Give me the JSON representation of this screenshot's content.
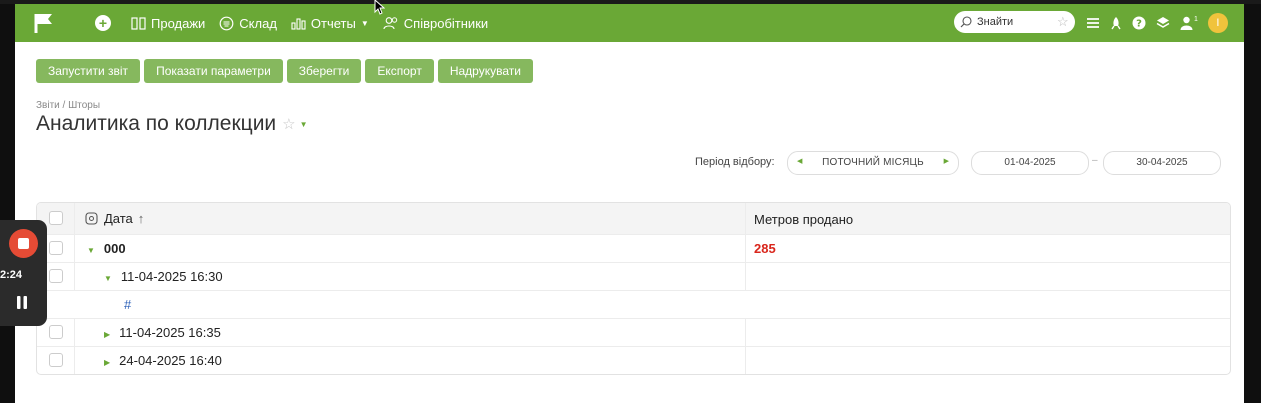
{
  "nav": {
    "menu": [
      {
        "label": "Продажи",
        "icon": "grid-icon",
        "caret": false
      },
      {
        "label": "Склад",
        "icon": "warehouse-icon",
        "caret": false
      },
      {
        "label": "Отчеты",
        "icon": "reports-icon",
        "caret": true
      },
      {
        "label": "Співробітники",
        "icon": "users-icon",
        "caret": false
      }
    ],
    "search_placeholder": "Знайти",
    "notification_count": "1",
    "avatar_letter": "I"
  },
  "toolbar": {
    "run_label": "Запустити звіт",
    "params_label": "Показати параметри",
    "save_label": "Зберегти",
    "export_label": "Експорт",
    "print_label": "Надрукувати"
  },
  "breadcrumb": "Звіти / Шторы",
  "page_title": "Аналитика по коллекции",
  "period": {
    "label": "Період відбору:",
    "value": "ПОТОЧНИЙ МІСЯЦЬ",
    "date_from": "01-04-2025",
    "date_sep": "–",
    "date_to": "30-04-2025"
  },
  "grid": {
    "col_date": "Дата",
    "sort_arrow": "↑",
    "col_metrics": "Метров продано",
    "rows": [
      {
        "date": "000",
        "metrics": "285"
      },
      {
        "date": "11-04-2025 16:30",
        "metrics": ""
      },
      {
        "date": "#",
        "metrics": ""
      },
      {
        "date": "11-04-2025 16:35",
        "metrics": ""
      },
      {
        "date": "24-04-2025 16:40",
        "metrics": ""
      }
    ]
  },
  "recorder": {
    "time": "2:24"
  },
  "colors": {
    "brand": "#6aa836",
    "button": "#86b85e",
    "accent_red": "#d9261c",
    "link": "#2a5fb8",
    "record": "#e54b35"
  }
}
